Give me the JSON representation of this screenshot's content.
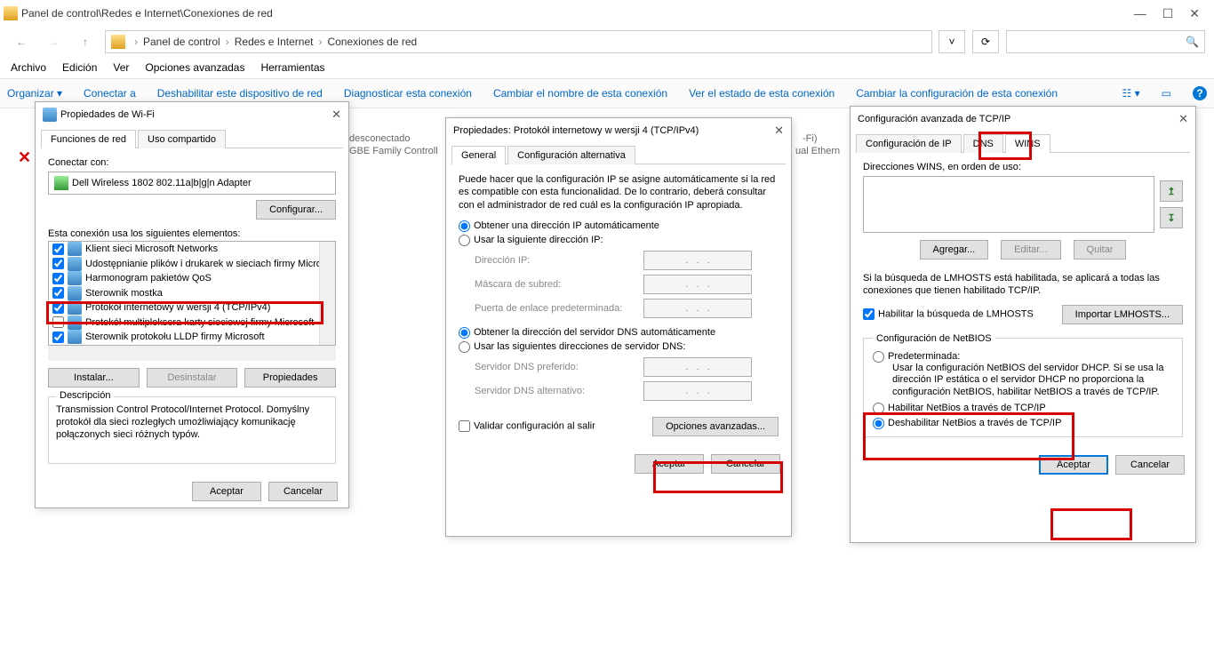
{
  "window": {
    "title": "Panel de control\\Redes e Internet\\Conexiones de red",
    "min_tooltip": "—",
    "max_tooltip": "☐",
    "close_tooltip": "✕"
  },
  "nav": {
    "crumbs": [
      "Panel de control",
      "Redes e Internet",
      "Conexiones de red"
    ],
    "search_placeholder": ""
  },
  "menubar": [
    "Archivo",
    "Edición",
    "Ver",
    "Opciones avanzadas",
    "Herramientas"
  ],
  "cmdbar": {
    "links": [
      "Organizar ▾",
      "Conectar a",
      "Deshabilitar este dispositivo de red",
      "Diagnosticar esta conexión",
      "Cambiar el nombre de esta conexión",
      "Ver el estado de esta conexión",
      "Cambiar la configuración de esta conexión"
    ]
  },
  "bg": {
    "status": "desconectado",
    "nic1": "GBE Family Controll",
    "wifi": "-Fi)",
    "nic2": "ual Ethern"
  },
  "dlg1": {
    "title": "Propiedades de Wi-Fi",
    "tabs": [
      "Funciones de red",
      "Uso compartido"
    ],
    "connect_with": "Conectar con:",
    "adapter": "Dell Wireless 1802 802.11a|b|g|n Adapter",
    "configure": "Configurar...",
    "uses": "Esta conexión usa los siguientes elementos:",
    "items": [
      "Klient sieci Microsoft Networks",
      "Udostępnianie plików i drukarek w sieciach firmy Micros",
      "Harmonogram pakietów QoS",
      "Sterownik mostka",
      "Protokół internetowy w wersji 4 (TCP/IPv4)",
      "Protokół multipleksera karty sieciowej firmy Microsoft",
      "Sterownik protokołu LLDP firmy Microsoft"
    ],
    "install": "Instalar...",
    "uninstall": "Desinstalar",
    "properties": "Propiedades",
    "desc_label": "Descripción",
    "desc": "Transmission Control Protocol/Internet Protocol. Domyślny protokół dla sieci rozległych umożliwiający komunikację połączonych sieci różnych typów.",
    "ok": "Aceptar",
    "cancel": "Cancelar"
  },
  "dlg2": {
    "title": "Propiedades: Protokół internetowy w wersji 4 (TCP/IPv4)",
    "tabs": [
      "General",
      "Configuración alternativa"
    ],
    "intro": "Puede hacer que la configuración IP se asigne automáticamente si la red es compatible con esta funcionalidad. De lo contrario, deberá consultar con el administrador de red cuál es la configuración IP apropiada.",
    "ip_auto": "Obtener una dirección IP automáticamente",
    "ip_manual": "Usar la siguiente dirección IP:",
    "ip_addr": "Dirección IP:",
    "mask": "Máscara de subred:",
    "gw": "Puerta de enlace predeterminada:",
    "dns_auto": "Obtener la dirección del servidor DNS automáticamente",
    "dns_manual": "Usar las siguientes direcciones de servidor DNS:",
    "dns1": "Servidor DNS preferido:",
    "dns2": "Servidor DNS alternativo:",
    "validate": "Validar configuración al salir",
    "advanced": "Opciones avanzadas...",
    "ok": "Aceptar",
    "cancel": "Cancelar"
  },
  "dlg3": {
    "title": "Configuración avanzada de TCP/IP",
    "tabs": [
      "Configuración de IP",
      "DNS",
      "WINS"
    ],
    "wins_label": "Direcciones WINS, en orden de uso:",
    "add": "Agregar...",
    "edit": "Editar...",
    "remove": "Quitar",
    "lmhosts_note": "Si la búsqueda de LMHOSTS está habilitada, se aplicará a todas las conexiones que tienen habilitado TCP/IP.",
    "lmhosts_check": "Habilitar la búsqueda de LMHOSTS",
    "import": "Importar LMHOSTS...",
    "netbios_legend": "Configuración de NetBIOS",
    "nb_default": "Predeterminada:",
    "nb_default_desc": "Usar la configuración NetBIOS del servidor DHCP. Si se usa la dirección IP estática o el servidor DHCP no proporciona la configuración NetBIOS, habilitar NetBIOS a través de TCP/IP.",
    "nb_enable": "Habilitar NetBios a través de TCP/IP",
    "nb_disable": "Deshabilitar NetBios a través de TCP/IP",
    "ok": "Aceptar",
    "cancel": "Cancelar"
  }
}
